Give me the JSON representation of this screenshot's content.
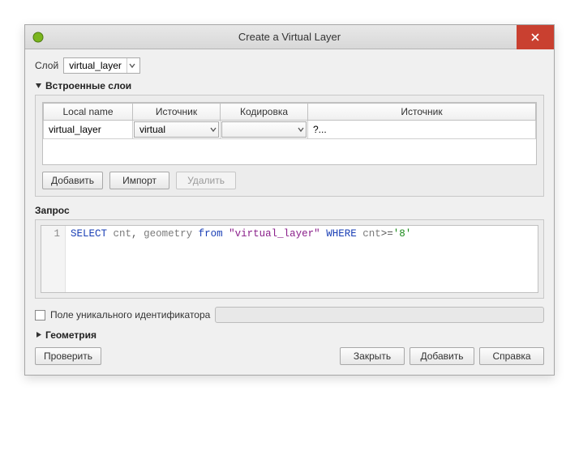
{
  "titlebar": {
    "title": "Create a Virtual Layer"
  },
  "layerRow": {
    "label": "Слой",
    "selected": "virtual_layer"
  },
  "embedded": {
    "header": "Встроенные слои",
    "columns": {
      "local_name": "Local name",
      "source": "Источник",
      "encoding": "Кодировка",
      "source2": "Источник"
    },
    "row": {
      "local_name": "virtual_layer",
      "source": "virtual",
      "encoding": "",
      "source2": "?..."
    },
    "buttons": {
      "add": "Добавить",
      "import": "Импорт",
      "delete": "Удалить"
    }
  },
  "query": {
    "label": "Запрос",
    "lineNo": "1",
    "tokens": {
      "select": "SELECT",
      "cnt": "cnt",
      "comma": ",",
      "geometry": "geometry",
      "from": "from",
      "table": "\"virtual_layer\"",
      "where": "WHERE",
      "cnt2": "cnt",
      "op": ">=",
      "val": "'8'"
    }
  },
  "uid": {
    "label": "Поле уникального идентификатора"
  },
  "geometry": {
    "header": "Геометрия"
  },
  "footer": {
    "test": "Проверить",
    "close": "Закрыть",
    "add": "Добавить",
    "help": "Справка"
  }
}
